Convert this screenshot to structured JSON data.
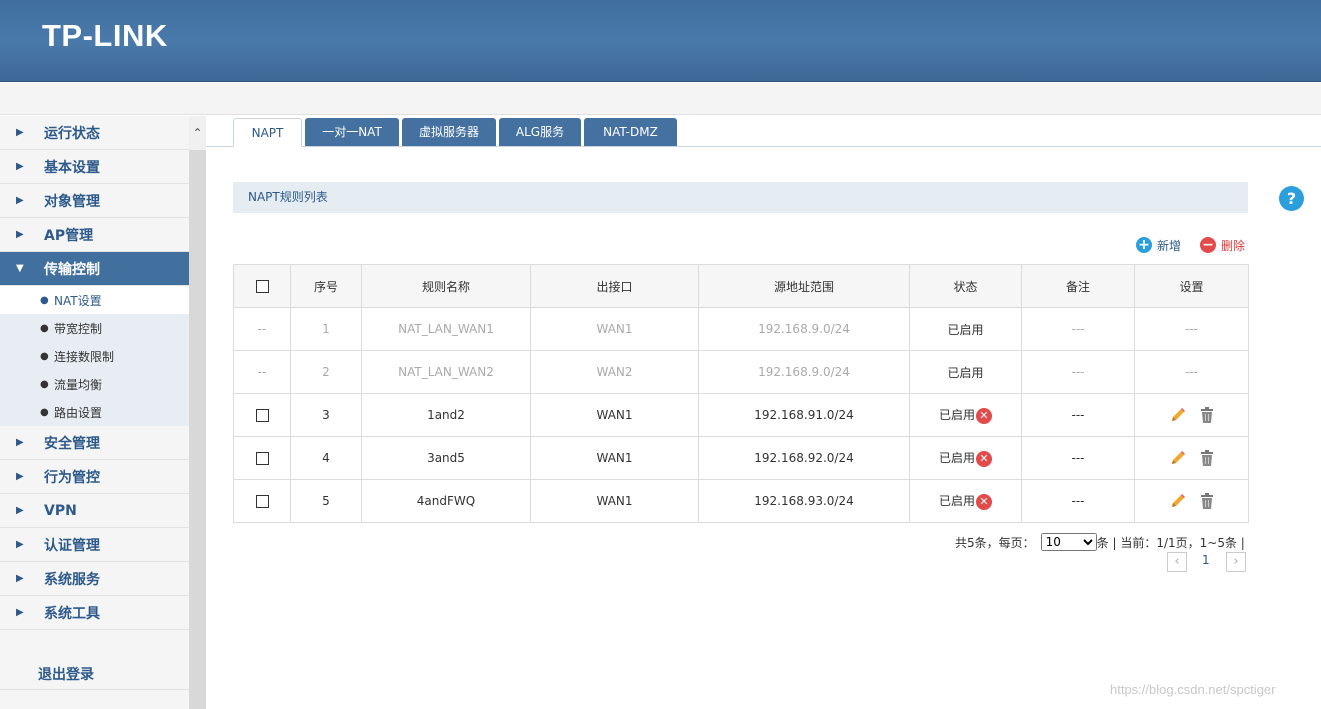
{
  "brand": {
    "logo": "TP-LINK"
  },
  "sidebar": {
    "items": [
      {
        "label": "运行状态"
      },
      {
        "label": "基本设置"
      },
      {
        "label": "对象管理"
      },
      {
        "label": "AP管理"
      },
      {
        "label": "传输控制"
      },
      {
        "label": "安全管理"
      },
      {
        "label": "行为管控"
      },
      {
        "label": "VPN"
      },
      {
        "label": "认证管理"
      },
      {
        "label": "系统服务"
      },
      {
        "label": "系统工具"
      }
    ],
    "subitems": [
      {
        "label": "NAT设置"
      },
      {
        "label": "带宽控制"
      },
      {
        "label": "连接数限制"
      },
      {
        "label": "流量均衡"
      },
      {
        "label": "路由设置"
      }
    ],
    "logout": "退出登录"
  },
  "tabs": [
    {
      "label": "NAPT"
    },
    {
      "label": "一对一NAT"
    },
    {
      "label": "虚拟服务器"
    },
    {
      "label": "ALG服务"
    },
    {
      "label": "NAT-DMZ"
    }
  ],
  "section": {
    "title": "NAPT规则列表"
  },
  "actions": {
    "add": "新增",
    "delete": "删除"
  },
  "table": {
    "headers": [
      "序号",
      "规则名称",
      "出接口",
      "源地址范围",
      "状态",
      "备注",
      "设置"
    ],
    "rows": [
      {
        "check": "--",
        "index": "1",
        "name": "NAT_LAN_WAN1",
        "iface": "WAN1",
        "src": "192.168.9.0/24",
        "status": "已启用",
        "note": "---",
        "setting": "---"
      },
      {
        "check": "--",
        "index": "2",
        "name": "NAT_LAN_WAN2",
        "iface": "WAN2",
        "src": "192.168.9.0/24",
        "status": "已启用",
        "note": "---",
        "setting": "---"
      },
      {
        "index": "3",
        "name": "1and2",
        "iface": "WAN1",
        "src": "192.168.91.0/24",
        "status": "已启用",
        "note": "---"
      },
      {
        "index": "4",
        "name": "3and5",
        "iface": "WAN1",
        "src": "192.168.92.0/24",
        "status": "已启用",
        "note": "---"
      },
      {
        "index": "5",
        "name": "4andFWQ",
        "iface": "WAN1",
        "src": "192.168.93.0/24",
        "status": "已启用",
        "note": "---"
      }
    ]
  },
  "pagination": {
    "total_prefix": "共5条，每页：",
    "page_size": "10",
    "suffix": "条 | 当前：1/1页，1~5条 |",
    "current_page": "1"
  },
  "watermark": "https://blog.csdn.net/spctiger",
  "colors": {
    "header": "#44719f",
    "accent": "#2d5a8a",
    "add": "#2a9fdc",
    "delete": "#e34a4a"
  }
}
